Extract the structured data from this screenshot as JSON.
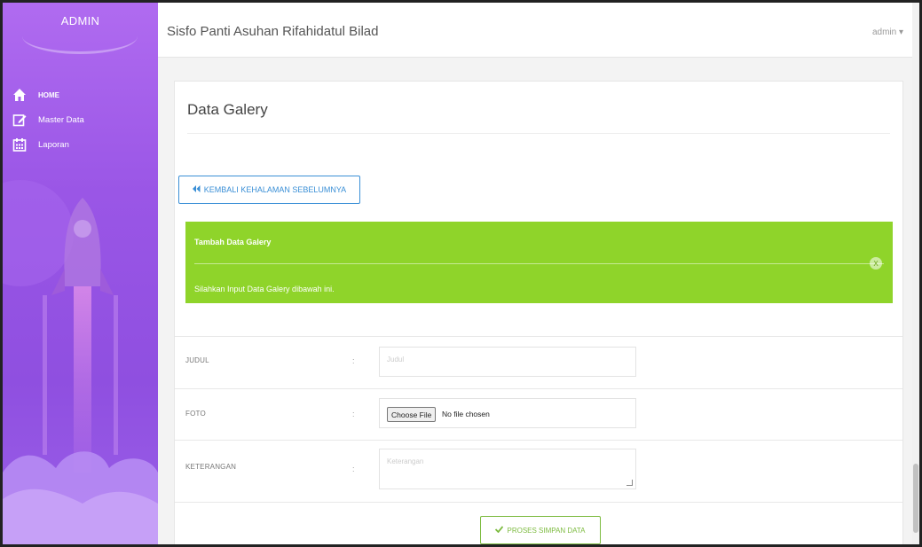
{
  "sidebar": {
    "brand": "ADMIN",
    "items": [
      {
        "label": "HOME",
        "icon": "home-icon"
      },
      {
        "label": "Master Data",
        "icon": "edit-icon"
      },
      {
        "label": "Laporan",
        "icon": "calendar-icon"
      }
    ]
  },
  "header": {
    "title": "Sisfo Panti Asuhan Rifahidatul Bilad",
    "user": "admin ▾"
  },
  "page": {
    "title": "Data Galery",
    "back_button": "KEMBALI KEHALAMAN SEBELUMNYA",
    "back_icon": "double-chevron-left-icon"
  },
  "alert": {
    "title": "Tambah Data Galery",
    "message": "Silahkan Input Data Galery dibawah ini.",
    "close": "X",
    "color": "#8fd42a"
  },
  "form": {
    "judul": {
      "label": "JUDUL",
      "colon": ":",
      "placeholder": "Judul"
    },
    "foto": {
      "label": "FOTO",
      "colon": ":",
      "button": "Choose File",
      "status": "No file chosen"
    },
    "keterangan": {
      "label": "KETERANGAN",
      "colon": ":",
      "placeholder": "Keterangan"
    },
    "submit": "PROSES SIMPAN DATA",
    "submit_icon": "check-icon"
  },
  "colors": {
    "sidebar": "#9a56e6",
    "primary": "#3a8fd6",
    "success": "#7dbb40"
  }
}
